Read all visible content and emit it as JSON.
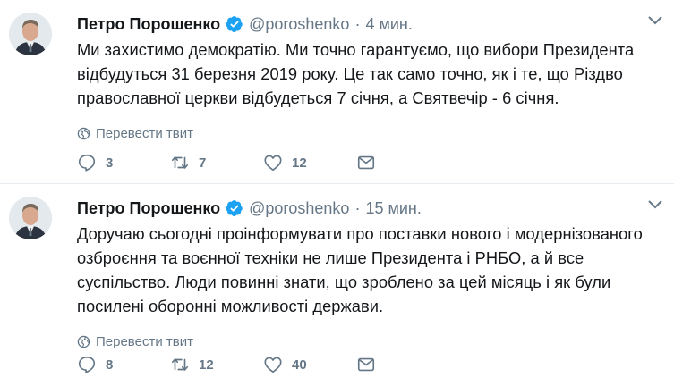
{
  "tweets": [
    {
      "name": "Петро Порошенко",
      "handle": "@poroshenko",
      "separator": "·",
      "time": "4 мин.",
      "text": "Ми захистимо демократію. Ми точно гарантуємо, що вибори Президента відбудуться 31 березня 2019 року. Це так само точно, як і те, що Різдво православної церкви відбудеться 7 січня, а Святвечір - 6 січня.",
      "translate": "Перевести твит",
      "replies": "3",
      "retweets": "7",
      "likes": "12"
    },
    {
      "name": "Петро Порошенко",
      "handle": "@poroshenko",
      "separator": "·",
      "time": "15 мин.",
      "text": "Доручаю сьогодні проінформувати про поставки нового і модернізованого озброєння та воєнної техніки не лише Президента і РНБО, а й все суспільство. Люди повинні знати, що зроблено за цей місяць і як були посилені оборонні можливості держави.",
      "translate": "Перевести твит",
      "replies": "8",
      "retweets": "12",
      "likes": "40"
    }
  ],
  "colors": {
    "verified": "#1da1f2",
    "muted": "#657786",
    "text": "#14171a",
    "divider": "#e6ecf0"
  },
  "icons": [
    "verified-badge-icon",
    "chevron-down-icon",
    "globe-icon",
    "reply-icon",
    "retweet-icon",
    "like-icon",
    "direct-message-icon"
  ]
}
